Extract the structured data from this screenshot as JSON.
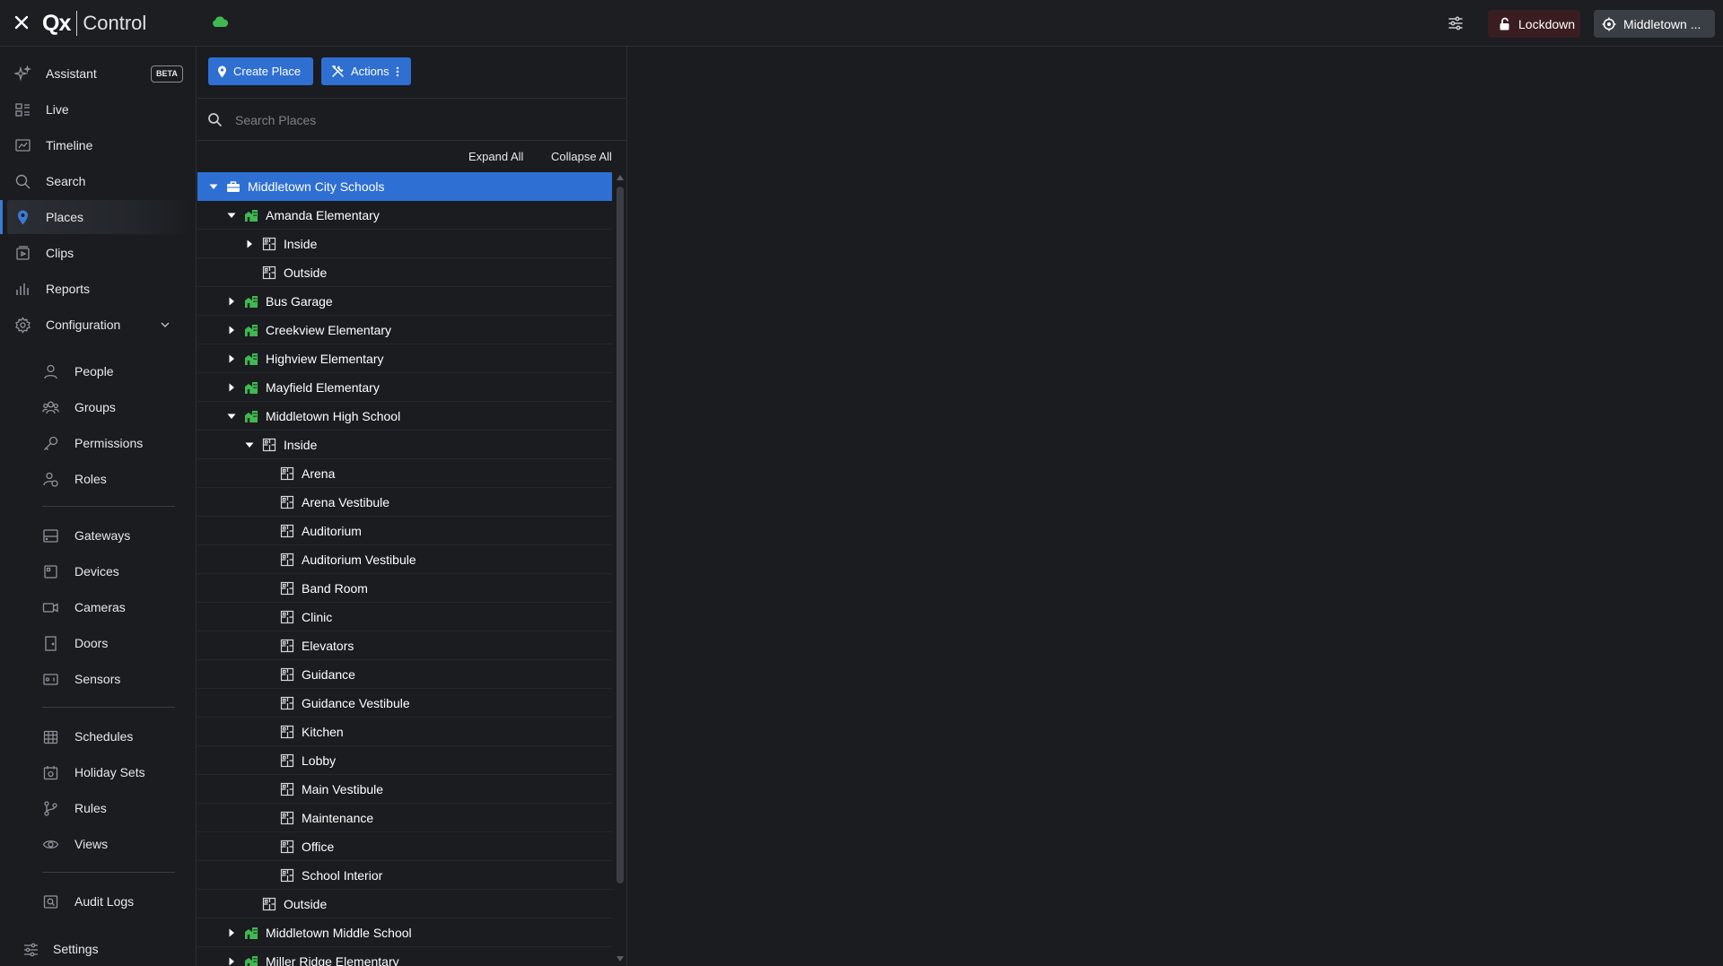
{
  "app": {
    "brand_mark": "Qx",
    "brand_name": "Control",
    "lockdown_label": "Lockdown",
    "site_label": "Middletown ...",
    "colors": {
      "accent": "#2f6fd1",
      "place_green": "#3fb950",
      "lockdown_bg": "#3a1d20"
    }
  },
  "sidebar": {
    "assistant": {
      "label": "Assistant",
      "badge": "BETA",
      "icon": "sparkle-icon"
    },
    "main_items": [
      {
        "label": "Live",
        "icon": "grid-icon"
      },
      {
        "label": "Timeline",
        "icon": "timeline-icon"
      },
      {
        "label": "Search",
        "icon": "search-icon"
      },
      {
        "label": "Places",
        "icon": "location-pin-icon",
        "active": true
      },
      {
        "label": "Clips",
        "icon": "clip-icon"
      },
      {
        "label": "Reports",
        "icon": "bar-chart-icon"
      },
      {
        "label": "Configuration",
        "icon": "gear-icon"
      }
    ],
    "config_items": [
      {
        "label": "People",
        "icon": "person-icon"
      },
      {
        "label": "Groups",
        "icon": "group-icon"
      },
      {
        "label": "Permissions",
        "icon": "key-icon"
      },
      {
        "label": "Roles",
        "icon": "role-icon"
      },
      {
        "label": "Gateways",
        "icon": "gateway-icon"
      },
      {
        "label": "Devices",
        "icon": "device-icon"
      },
      {
        "label": "Cameras",
        "icon": "camera-icon"
      },
      {
        "label": "Doors",
        "icon": "door-icon"
      },
      {
        "label": "Sensors",
        "icon": "sensor-icon"
      },
      {
        "label": "Schedules",
        "icon": "calendar-icon"
      },
      {
        "label": "Holiday Sets",
        "icon": "holiday-icon"
      },
      {
        "label": "Rules",
        "icon": "branch-icon"
      },
      {
        "label": "Views",
        "icon": "eye-icon"
      },
      {
        "label": "Audit Logs",
        "icon": "audit-icon"
      }
    ],
    "settings_label": "Settings"
  },
  "places": {
    "create_label": "Create Place",
    "actions_label": "Actions",
    "search_placeholder": "Search Places",
    "expand_all": "Expand All",
    "collapse_all": "Collapse All",
    "tree": [
      {
        "label": "Middletown City Schools",
        "level": 0,
        "type": "org",
        "caret": "down",
        "selected": true
      },
      {
        "label": "Amanda Elementary",
        "level": 1,
        "type": "building",
        "caret": "down"
      },
      {
        "label": "Inside",
        "level": 2,
        "type": "area",
        "caret": "right"
      },
      {
        "label": "Outside",
        "level": 2,
        "type": "area",
        "caret": "none"
      },
      {
        "label": "Bus Garage",
        "level": 1,
        "type": "building",
        "caret": "right"
      },
      {
        "label": "Creekview Elementary",
        "level": 1,
        "type": "building",
        "caret": "right"
      },
      {
        "label": "Highview Elementary",
        "level": 1,
        "type": "building",
        "caret": "right"
      },
      {
        "label": "Mayfield Elementary",
        "level": 1,
        "type": "building",
        "caret": "right"
      },
      {
        "label": "Middletown High School",
        "level": 1,
        "type": "building",
        "caret": "down"
      },
      {
        "label": "Inside",
        "level": 2,
        "type": "area",
        "caret": "down"
      },
      {
        "label": "Arena",
        "level": 3,
        "type": "area",
        "caret": "none"
      },
      {
        "label": "Arena Vestibule",
        "level": 3,
        "type": "area",
        "caret": "none"
      },
      {
        "label": "Auditorium",
        "level": 3,
        "type": "area",
        "caret": "none"
      },
      {
        "label": "Auditorium Vestibule",
        "level": 3,
        "type": "area",
        "caret": "none"
      },
      {
        "label": "Band Room",
        "level": 3,
        "type": "area",
        "caret": "none"
      },
      {
        "label": "Clinic",
        "level": 3,
        "type": "area",
        "caret": "none"
      },
      {
        "label": "Elevators",
        "level": 3,
        "type": "area",
        "caret": "none"
      },
      {
        "label": "Guidance",
        "level": 3,
        "type": "area",
        "caret": "none"
      },
      {
        "label": "Guidance Vestibule",
        "level": 3,
        "type": "area",
        "caret": "none"
      },
      {
        "label": "Kitchen",
        "level": 3,
        "type": "area",
        "caret": "none"
      },
      {
        "label": "Lobby",
        "level": 3,
        "type": "area",
        "caret": "none"
      },
      {
        "label": "Main Vestibule",
        "level": 3,
        "type": "area",
        "caret": "none"
      },
      {
        "label": "Maintenance",
        "level": 3,
        "type": "area",
        "caret": "none"
      },
      {
        "label": "Office",
        "level": 3,
        "type": "area",
        "caret": "none"
      },
      {
        "label": "School Interior",
        "level": 3,
        "type": "area",
        "caret": "none"
      },
      {
        "label": "Outside",
        "level": 2,
        "type": "area",
        "caret": "none"
      },
      {
        "label": "Middletown Middle School",
        "level": 1,
        "type": "building",
        "caret": "right"
      },
      {
        "label": "Miller Ridge Elementary",
        "level": 1,
        "type": "building",
        "caret": "right"
      }
    ]
  }
}
